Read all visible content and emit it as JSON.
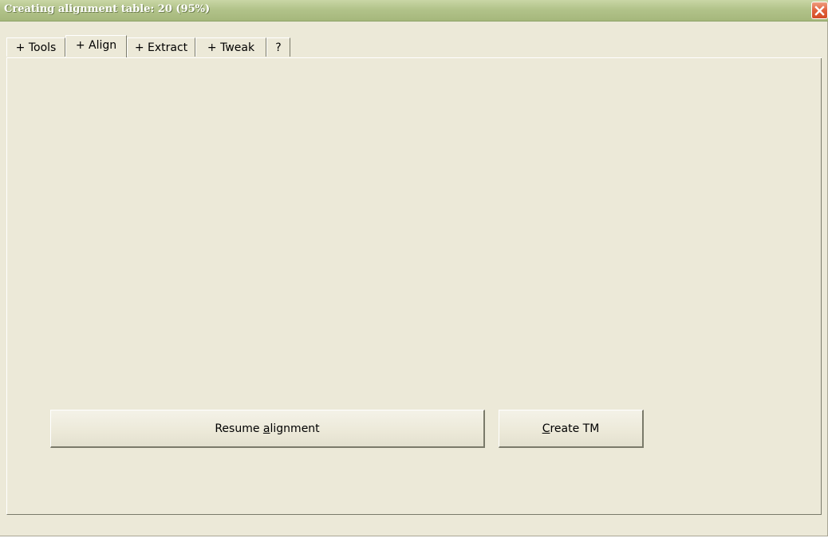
{
  "window": {
    "title": "Creating alignment table: 20 (95%)",
    "close_icon": "close-icon",
    "colors": {
      "title_bar": "#b2c38a",
      "face": "#ece9d8",
      "close_button": "#e0603b"
    }
  },
  "tabs": [
    {
      "label": "+ Tools",
      "active": false
    },
    {
      "label": "+ Align",
      "active": true
    },
    {
      "label": "+ Extract",
      "active": false
    },
    {
      "label": "+ Tweak",
      "active": false
    },
    {
      "label": "?",
      "active": false
    }
  ],
  "buttons": {
    "resume": {
      "prefix": "Resume ",
      "mnemonic": "a",
      "suffix": "lignment"
    },
    "create_tm": {
      "prefix": "",
      "mnemonic": "C",
      "suffix": "reate TM"
    }
  }
}
